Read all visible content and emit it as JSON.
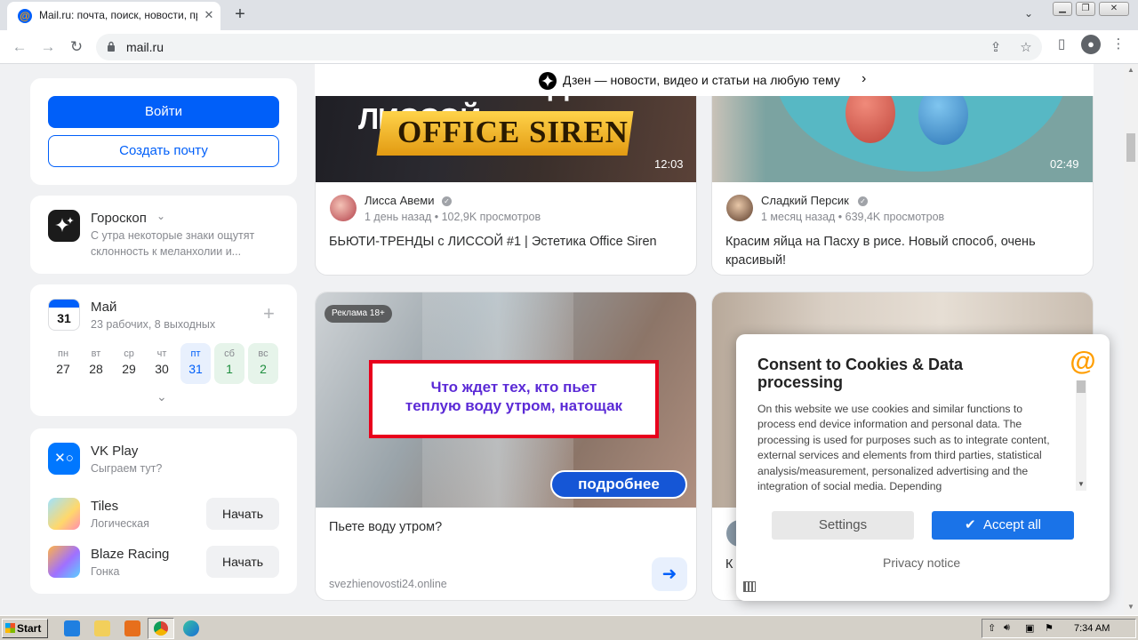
{
  "browser": {
    "tab_title": "Mail.ru: почта, поиск, новости, пр",
    "tab_close": "✕",
    "new_tab": "+",
    "url": "mail.ru",
    "favicon": "@"
  },
  "dzen_bar": {
    "text": "Дзен — новости, видео и статьи на любую тему",
    "chevron": "›"
  },
  "auth": {
    "login_label": "Войти",
    "create_label": "Создать почту"
  },
  "horoscope": {
    "title": "Гороскоп",
    "text_line1": "С утра некоторые знаки ощутят",
    "text_line2": "склонность к меланхолии и..."
  },
  "calendar": {
    "icon_day": "31",
    "month": "Май",
    "summary": "23 рабочих, 8 выходных",
    "add": "+",
    "days": [
      {
        "name": "пн",
        "date": "27"
      },
      {
        "name": "вт",
        "date": "28"
      },
      {
        "name": "ср",
        "date": "29"
      },
      {
        "name": "чт",
        "date": "30"
      },
      {
        "name": "пт",
        "date": "31"
      },
      {
        "name": "сб",
        "date": "1"
      },
      {
        "name": "вс",
        "date": "2"
      }
    ]
  },
  "vkplay": {
    "title": "VK Play",
    "subtitle": "Сыграем тут?",
    "games": [
      {
        "name": "Tiles",
        "genre": "Логическая",
        "button": "Начать"
      },
      {
        "name": "Blaze Racing",
        "genre": "Гонка",
        "button": "Начать"
      }
    ]
  },
  "videos": [
    {
      "thumb_line1": "БЬЮТИ-ТРЕНДЫ С ЛИССОЙ",
      "thumb_line2": "OFFICE SIREN",
      "duration": "12:03",
      "author": "Лисса Авеми",
      "meta": "1 день назад • 102,9K просмотров",
      "title": "БЬЮТИ-ТРЕНДЫ с ЛИССОЙ #1 | Эстетика Office Siren"
    },
    {
      "duration": "02:49",
      "author": "Сладкий Персик",
      "meta": "1 месяц назад • 639,4K просмотров",
      "title_line1": "Красим яйца на Пасху в рисе. Новый способ, очень",
      "title_line2": "красивый!"
    }
  ],
  "ad": {
    "badge": "Реклама 18+",
    "headline_line1": "Что ждет тех, кто пьет",
    "headline_line2": "теплую воду утром, натощак",
    "cta": "подробнее",
    "title": "Пьете воду утром?",
    "domain": "svezhienovosti24.online"
  },
  "partial_card": {
    "title_fragment": "К"
  },
  "consent": {
    "title": "Consent to Cookies & Data processing",
    "body": "On this website we use cookies and similar functions to process end device information and personal data. The processing is used for purposes such as to integrate content, external services and elements from third parties, statistical analysis/measurement, personalized advertising and the integration of social media. Depending",
    "settings_label": "Settings",
    "accept_label": "Accept all",
    "privacy_label": "Privacy notice"
  },
  "taskbar": {
    "start_label": "Start",
    "clock": "7:34 AM"
  },
  "colors": {
    "accent": "#005ff9",
    "page_bg": "#f0f1f3",
    "consent_accept": "#1a73e8"
  }
}
